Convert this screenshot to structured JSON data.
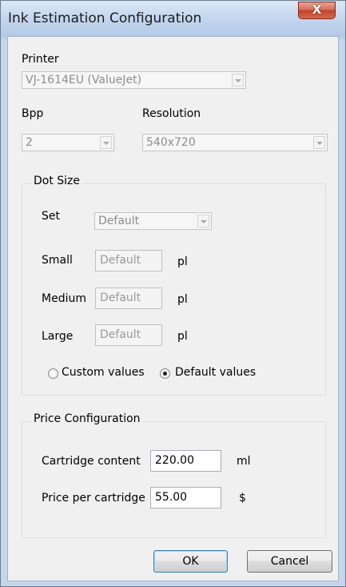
{
  "window": {
    "title": "Ink Estimation Configuration",
    "close_glyph": "X"
  },
  "printer": {
    "label": "Printer",
    "value": "VJ-1614EU (ValueJet)"
  },
  "bpp": {
    "label": "Bpp",
    "value": "2"
  },
  "resolution": {
    "label": "Resolution",
    "value": "540x720"
  },
  "dot_size": {
    "title": "Dot Size",
    "set_label": "Set",
    "set_value": "Default",
    "small_label": "Small",
    "small_value": "Default",
    "medium_label": "Medium",
    "medium_value": "Default",
    "large_label": "Large",
    "large_value": "Default",
    "unit": "pl",
    "radio_custom_label": "Custom values",
    "radio_default_label": "Default values",
    "selected": "default"
  },
  "price": {
    "title": "Price Configuration",
    "cartridge_label": "Cartridge content",
    "cartridge_value": "220.00",
    "cartridge_unit": "ml",
    "price_label": "Price per cartridge",
    "price_value": "55.00",
    "price_unit": "$"
  },
  "buttons": {
    "ok": "OK",
    "cancel": "Cancel"
  }
}
